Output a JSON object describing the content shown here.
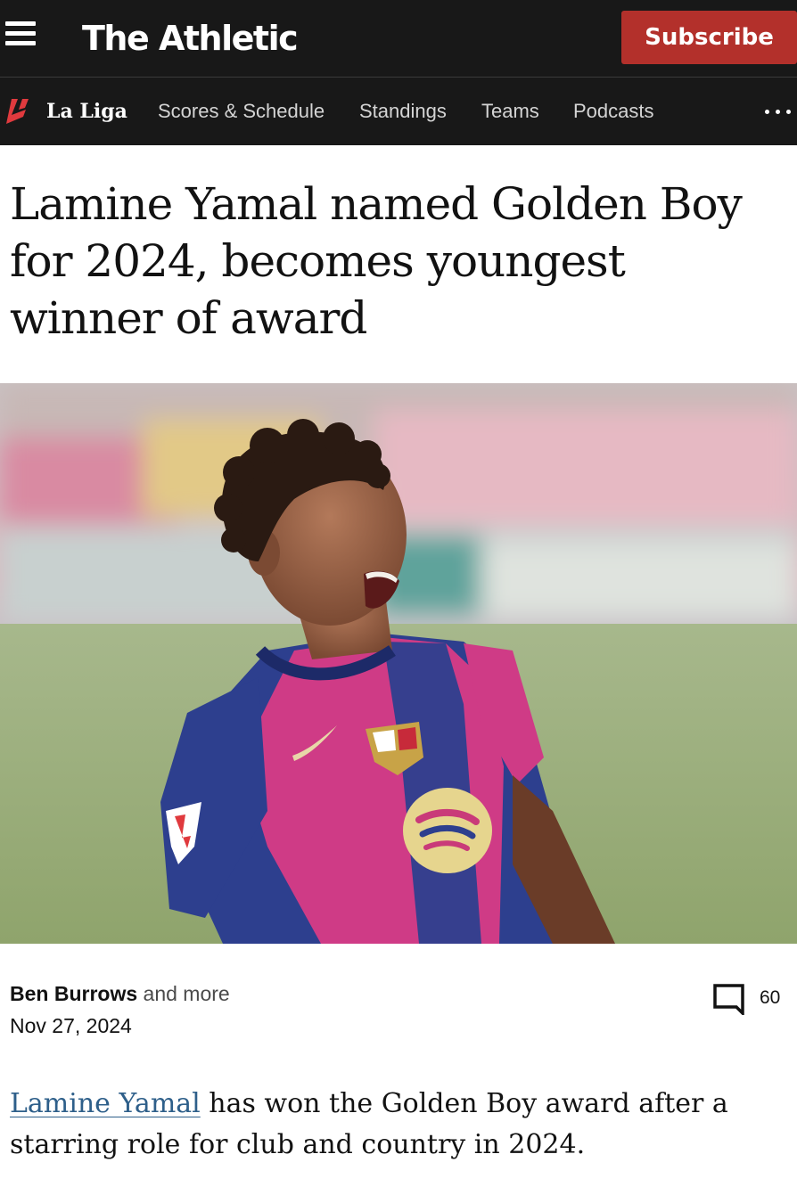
{
  "header": {
    "logo": "The Athletic",
    "subscribe_label": "Subscribe"
  },
  "subnav": {
    "league": "La Liga",
    "items": [
      {
        "label": "Scores & Schedule"
      },
      {
        "label": "Standings"
      },
      {
        "label": "Teams"
      },
      {
        "label": "Podcasts"
      }
    ],
    "more_icon": "ellipsis-icon"
  },
  "article": {
    "headline": "Lamine Yamal named Golden Boy for 2024, becomes youngest winner of award",
    "author": "Ben Burrows",
    "author_suffix": " and more",
    "date": "Nov 27, 2024",
    "comment_count": "60",
    "lead_link": "Lamine Yamal",
    "lead_text": " has won the Golden Boy award after a starring role for club and country in 2024."
  },
  "colors": {
    "header_bg": "#181818",
    "subscribe_bg": "#b3302b",
    "link": "#2e5f8a",
    "laliga_accent": "#e03a3e"
  },
  "icons": [
    "menu-icon",
    "laliga-logo-icon",
    "ellipsis-icon",
    "comment-icon"
  ]
}
